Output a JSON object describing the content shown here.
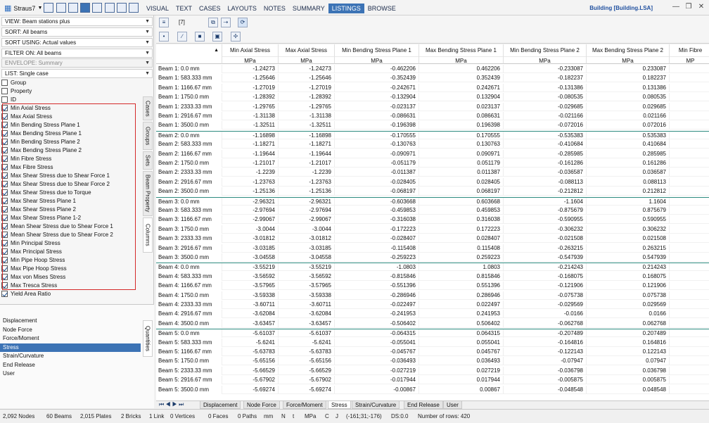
{
  "app": {
    "title": "Straus7",
    "document_title": "Building [Building.LSA]"
  },
  "menu": [
    "VISUAL",
    "TEXT",
    "CASES",
    "LAYOUTS",
    "NOTES",
    "SUMMARY",
    "LISTINGS",
    "BROWSE"
  ],
  "menu_active": "LISTINGS",
  "left": {
    "view": "VIEW: Beam stations plus",
    "sort": "SORT: All beams",
    "sort_using": "SORT USING: Actual values",
    "filter": "FILTER ON: All beams",
    "envelope": "ENVELOPE: Summary",
    "list": "LIST: Single case",
    "checkboxes": [
      {
        "label": "Group",
        "checked": false
      },
      {
        "label": "Property",
        "checked": false
      },
      {
        "label": "ID",
        "checked": false
      },
      {
        "label": "Min Axial Stress",
        "checked": true
      },
      {
        "label": "Max Axial Stress",
        "checked": true
      },
      {
        "label": "Min Bending Stress Plane 1",
        "checked": true
      },
      {
        "label": "Max Bending Stress Plane 1",
        "checked": true
      },
      {
        "label": "Min Bending Stress Plane 2",
        "checked": true
      },
      {
        "label": "Max Bending Stress Plane 2",
        "checked": true
      },
      {
        "label": "Min Fibre Stress",
        "checked": true
      },
      {
        "label": "Max Fibre Stress",
        "checked": true
      },
      {
        "label": "Max Shear Stress due to Shear Force 1",
        "checked": true
      },
      {
        "label": "Max Shear Stress due to Shear Force 2",
        "checked": true
      },
      {
        "label": "Max Shear Stress due to Torque",
        "checked": true
      },
      {
        "label": "Max Shear Stress Plane 1",
        "checked": true
      },
      {
        "label": "Max Shear Stress Plane 2",
        "checked": true
      },
      {
        "label": "Max Shear Stress Plane 1-2",
        "checked": true
      },
      {
        "label": "Mean Shear Stress due to Shear Force 1",
        "checked": true
      },
      {
        "label": "Mean Shear Stress due to Shear Force 2",
        "checked": true
      },
      {
        "label": "Min Principal Stress",
        "checked": true
      },
      {
        "label": "Max Principal Stress",
        "checked": true
      },
      {
        "label": "Min Pipe Hoop Stress",
        "checked": true
      },
      {
        "label": "Max Pipe Hoop Stress",
        "checked": true
      },
      {
        "label": "Max von Mises Stress",
        "checked": true
      },
      {
        "label": "Max Tresca Stress",
        "checked": true
      },
      {
        "label": "Yield Area Ratio",
        "checked": true
      }
    ],
    "vtabs": [
      "Cases",
      "Groups",
      "Sets",
      "Beam Property",
      "Columns"
    ],
    "vtab_active": "Columns",
    "quantities_tab": "Quantities",
    "quantities": [
      "Displacement",
      "Node Force",
      "Force/Moment",
      "Stress",
      "Strain/Curvature",
      "End Release",
      "User"
    ],
    "quantity_active": "Stress"
  },
  "toolbar": {
    "columns_count": "[7]"
  },
  "table": {
    "columns": [
      {
        "name": "Min Axial Stress",
        "unit": "MPa"
      },
      {
        "name": "Max Axial Stress",
        "unit": "MPa"
      },
      {
        "name": "Min Bending Stress Plane 1",
        "unit": "MPa"
      },
      {
        "name": "Max Bending Stress Plane 1",
        "unit": "MPa"
      },
      {
        "name": "Min Bending Stress Plane 2",
        "unit": "MPa"
      },
      {
        "name": "Max Bending Stress Plane 2",
        "unit": "MPa"
      },
      {
        "name": "Min Fibre",
        "unit": "MP"
      }
    ],
    "rows": [
      {
        "label": "Beam 1: 0.0 mm",
        "v": [
          "-1.24273",
          "-1.24273",
          "-0.462206",
          "0.462206",
          "-0.233087",
          "0.233087"
        ]
      },
      {
        "label": "Beam 1: 583.333 mm",
        "v": [
          "-1.25646",
          "-1.25646",
          "-0.352439",
          "0.352439",
          "-0.182237",
          "0.182237"
        ]
      },
      {
        "label": "Beam 1: 1166.67 mm",
        "v": [
          "-1.27019",
          "-1.27019",
          "-0.242671",
          "0.242671",
          "-0.131386",
          "0.131386"
        ]
      },
      {
        "label": "Beam 1: 1750.0 mm",
        "v": [
          "-1.28392",
          "-1.28392",
          "-0.132904",
          "0.132904",
          "-0.080535",
          "0.080535"
        ]
      },
      {
        "label": "Beam 1: 2333.33 mm",
        "v": [
          "-1.29765",
          "-1.29765",
          "-0.023137",
          "0.023137",
          "-0.029685",
          "0.029685"
        ]
      },
      {
        "label": "Beam 1: 2916.67 mm",
        "v": [
          "-1.31138",
          "-1.31138",
          "-0.086631",
          "0.086631",
          "-0.021166",
          "0.021166"
        ]
      },
      {
        "label": "Beam 1: 3500.0 mm",
        "v": [
          "-1.32511",
          "-1.32511",
          "-0.196398",
          "0.196398",
          "-0.072016",
          "0.072016"
        ]
      },
      {
        "label": "Beam 2: 0.0 mm",
        "v": [
          "-1.16898",
          "-1.16898",
          "-0.170555",
          "0.170555",
          "-0.535383",
          "0.535383"
        ]
      },
      {
        "label": "Beam 2: 583.333 mm",
        "v": [
          "-1.18271",
          "-1.18271",
          "-0.130763",
          "0.130763",
          "-0.410684",
          "0.410684"
        ]
      },
      {
        "label": "Beam 2: 1166.67 mm",
        "v": [
          "-1.19644",
          "-1.19644",
          "-0.090971",
          "0.090971",
          "-0.285985",
          "0.285985"
        ]
      },
      {
        "label": "Beam 2: 1750.0 mm",
        "v": [
          "-1.21017",
          "-1.21017",
          "-0.051179",
          "0.051179",
          "-0.161286",
          "0.161286"
        ]
      },
      {
        "label": "Beam 2: 2333.33 mm",
        "v": [
          "-1.2239",
          "-1.2239",
          "-0.011387",
          "0.011387",
          "-0.036587",
          "0.036587"
        ]
      },
      {
        "label": "Beam 2: 2916.67 mm",
        "v": [
          "-1.23763",
          "-1.23763",
          "-0.028405",
          "0.028405",
          "-0.088113",
          "0.088113"
        ]
      },
      {
        "label": "Beam 2: 3500.0 mm",
        "v": [
          "-1.25136",
          "-1.25136",
          "-0.068197",
          "0.068197",
          "-0.212812",
          "0.212812"
        ]
      },
      {
        "label": "Beam 3: 0.0 mm",
        "v": [
          "-2.96321",
          "-2.96321",
          "-0.603668",
          "0.603668",
          "-1.1604",
          "1.1604"
        ]
      },
      {
        "label": "Beam 3: 583.333 mm",
        "v": [
          "-2.97694",
          "-2.97694",
          "-0.459853",
          "0.459853",
          "-0.875679",
          "0.875679"
        ]
      },
      {
        "label": "Beam 3: 1166.67 mm",
        "v": [
          "-2.99067",
          "-2.99067",
          "-0.316038",
          "0.316038",
          "-0.590955",
          "0.590955"
        ]
      },
      {
        "label": "Beam 3: 1750.0 mm",
        "v": [
          "-3.0044",
          "-3.0044",
          "-0.172223",
          "0.172223",
          "-0.306232",
          "0.306232"
        ]
      },
      {
        "label": "Beam 3: 2333.33 mm",
        "v": [
          "-3.01812",
          "-3.01812",
          "-0.028407",
          "0.028407",
          "-0.021508",
          "0.021508"
        ]
      },
      {
        "label": "Beam 3: 2916.67 mm",
        "v": [
          "-3.03185",
          "-3.03185",
          "-0.115408",
          "0.115408",
          "-0.263215",
          "0.263215"
        ]
      },
      {
        "label": "Beam 3: 3500.0 mm",
        "v": [
          "-3.04558",
          "-3.04558",
          "-0.259223",
          "0.259223",
          "-0.547939",
          "0.547939"
        ]
      },
      {
        "label": "Beam 4: 0.0 mm",
        "v": [
          "-3.55219",
          "-3.55219",
          "-1.0803",
          "1.0803",
          "-0.214243",
          "0.214243"
        ]
      },
      {
        "label": "Beam 4: 583.333 mm",
        "v": [
          "-3.56592",
          "-3.56592",
          "-0.815846",
          "0.815846",
          "-0.168075",
          "0.168075"
        ]
      },
      {
        "label": "Beam 4: 1166.67 mm",
        "v": [
          "-3.57965",
          "-3.57965",
          "-0.551396",
          "0.551396",
          "-0.121906",
          "0.121906"
        ]
      },
      {
        "label": "Beam 4: 1750.0 mm",
        "v": [
          "-3.59338",
          "-3.59338",
          "-0.286946",
          "0.286946",
          "-0.075738",
          "0.075738"
        ]
      },
      {
        "label": "Beam 4: 2333.33 mm",
        "v": [
          "-3.60711",
          "-3.60711",
          "-0.022497",
          "0.022497",
          "-0.029569",
          "0.029569"
        ]
      },
      {
        "label": "Beam 4: 2916.67 mm",
        "v": [
          "-3.62084",
          "-3.62084",
          "-0.241953",
          "0.241953",
          "-0.0166",
          "0.0166"
        ]
      },
      {
        "label": "Beam 4: 3500.0 mm",
        "v": [
          "-3.63457",
          "-3.63457",
          "-0.506402",
          "0.506402",
          "-0.062768",
          "0.062768"
        ]
      },
      {
        "label": "Beam 5: 0.0 mm",
        "v": [
          "-5.61037",
          "-5.61037",
          "-0.064315",
          "0.064315",
          "-0.207489",
          "0.207489"
        ]
      },
      {
        "label": "Beam 5: 583.333 mm",
        "v": [
          "-5.6241",
          "-5.6241",
          "-0.055041",
          "0.055041",
          "-0.164816",
          "0.164816"
        ]
      },
      {
        "label": "Beam 5: 1166.67 mm",
        "v": [
          "-5.63783",
          "-5.63783",
          "-0.045767",
          "0.045767",
          "-0.122143",
          "0.122143"
        ]
      },
      {
        "label": "Beam 5: 1750.0 mm",
        "v": [
          "-5.65156",
          "-5.65156",
          "-0.036493",
          "0.036493",
          "-0.07947",
          "0.07947"
        ]
      },
      {
        "label": "Beam 5: 2333.33 mm",
        "v": [
          "-5.66529",
          "-5.66529",
          "-0.027219",
          "0.027219",
          "-0.036798",
          "0.036798"
        ]
      },
      {
        "label": "Beam 5: 2916.67 mm",
        "v": [
          "-5.67902",
          "-5.67902",
          "-0.017944",
          "0.017944",
          "-0.005875",
          "0.005875"
        ]
      },
      {
        "label": "Beam 5: 3500.0 mm",
        "v": [
          "-5.69274",
          "-5.69274",
          "-0.00867",
          "0.00867",
          "-0.048548",
          "0.048548"
        ]
      }
    ]
  },
  "bottom_tabs": [
    "Displacement",
    "Node Force",
    "Force/Moment",
    "Stress",
    "Strain/Curvature",
    "End Release",
    "User"
  ],
  "bottom_tab_active": "Stress",
  "status": {
    "nodes": "2,092 Nodes",
    "beams": "60 Beams",
    "plates": "2,015 Plates",
    "bricks": "2 Bricks",
    "links": "1 Link",
    "vertices": "0 Vertices",
    "faces": "0 Faces",
    "paths": "0 Paths",
    "unit_len": "mm",
    "unit_force": "N",
    "unit_temp": "t",
    "unit_stress": "MPa",
    "unit_c": "C",
    "unit_j": "J",
    "coords": "(-161;31;-176)",
    "ds": "DS:0.0",
    "rows": "Number of rows: 420"
  }
}
